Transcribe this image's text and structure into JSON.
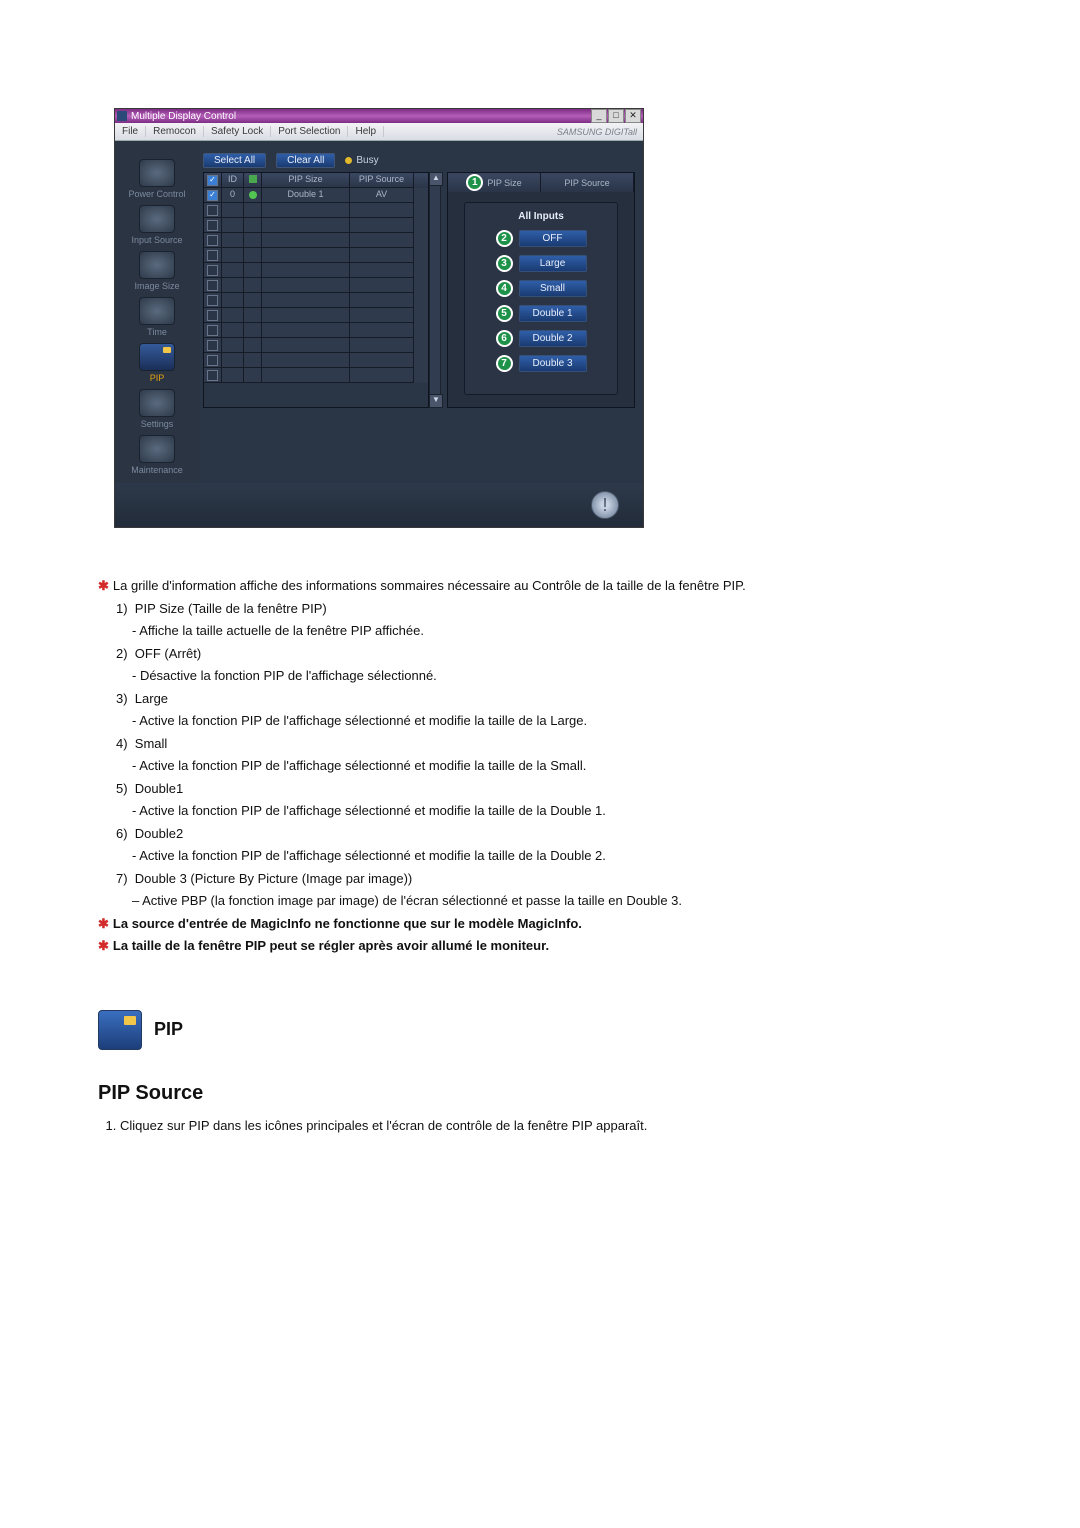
{
  "window": {
    "title": "Multiple Display Control",
    "brand": "SAMSUNG DIGITall"
  },
  "menu": [
    "File",
    "Remocon",
    "Safety Lock",
    "Port Selection",
    "Help"
  ],
  "sidebar": [
    {
      "label": "Power Control"
    },
    {
      "label": "Input Source"
    },
    {
      "label": "Image Size"
    },
    {
      "label": "Time"
    },
    {
      "label": "PIP",
      "active": true
    },
    {
      "label": "Settings"
    },
    {
      "label": "Maintenance"
    }
  ],
  "toolbar": {
    "select_all": "Select All",
    "clear_all": "Clear All",
    "busy": "Busy"
  },
  "grid": {
    "headers": {
      "chk": "☑",
      "id": "ID",
      "status": "",
      "size": "PIP Size",
      "source": "PIP Source"
    },
    "rows": [
      {
        "checked": true,
        "id": "0",
        "status": "ok",
        "size": "Double 1",
        "source": "AV"
      }
    ],
    "blank_row_count": 12
  },
  "right_panel": {
    "head": {
      "badge": "1",
      "col1": "PIP Size",
      "col2": "PIP Source"
    },
    "all_inputs": "All Inputs",
    "options": [
      {
        "num": "2",
        "label": "OFF"
      },
      {
        "num": "3",
        "label": "Large"
      },
      {
        "num": "4",
        "label": "Small"
      },
      {
        "num": "5",
        "label": "Double 1"
      },
      {
        "num": "6",
        "label": "Double 2"
      },
      {
        "num": "7",
        "label": "Double 3"
      }
    ]
  },
  "doc": {
    "intro": "La grille d'information affiche des informations sommaires nécessaire au Contrôle de la taille de la fenêtre PIP.",
    "items": [
      {
        "num": "1)",
        "title": "PIP Size (Taille de la fenêtre PIP)",
        "desc": "- Affiche la taille actuelle de la fenêtre PIP affichée."
      },
      {
        "num": "2)",
        "title": "OFF (Arrêt)",
        "desc": "- Désactive la fonction PIP de l'affichage sélectionné."
      },
      {
        "num": "3)",
        "title": "Large",
        "desc": "- Active la fonction PIP de l'affichage sélectionné et modifie la taille de la Large."
      },
      {
        "num": "4)",
        "title": "Small",
        "desc": "- Active la fonction PIP de l'affichage sélectionné et modifie la taille de la Small."
      },
      {
        "num": "5)",
        "title": "Double1",
        "desc": "- Active la fonction PIP de l'affichage sélectionné et modifie la taille de la Double 1."
      },
      {
        "num": "6)",
        "title": "Double2",
        "desc": "- Active la fonction PIP de l'affichage sélectionné et modifie la taille de la Double 2."
      },
      {
        "num": "7)",
        "title": "Double 3 (Picture By Picture (Image par image))",
        "desc": "– Active PBP (la fonction image par image) de l'écran sélectionné et passe la taille en Double 3."
      }
    ],
    "notes": [
      "La source d'entrée de MagicInfo ne fonctionne que sur le modèle MagicInfo.",
      "La taille de la fenêtre PIP peut se régler après avoir allumé le moniteur."
    ],
    "pip_heading": "PIP",
    "section_title": "PIP Source",
    "section_item": "Cliquez sur PIP dans les icônes principales et l'écran de contrôle de la fenêtre PIP apparaît."
  }
}
